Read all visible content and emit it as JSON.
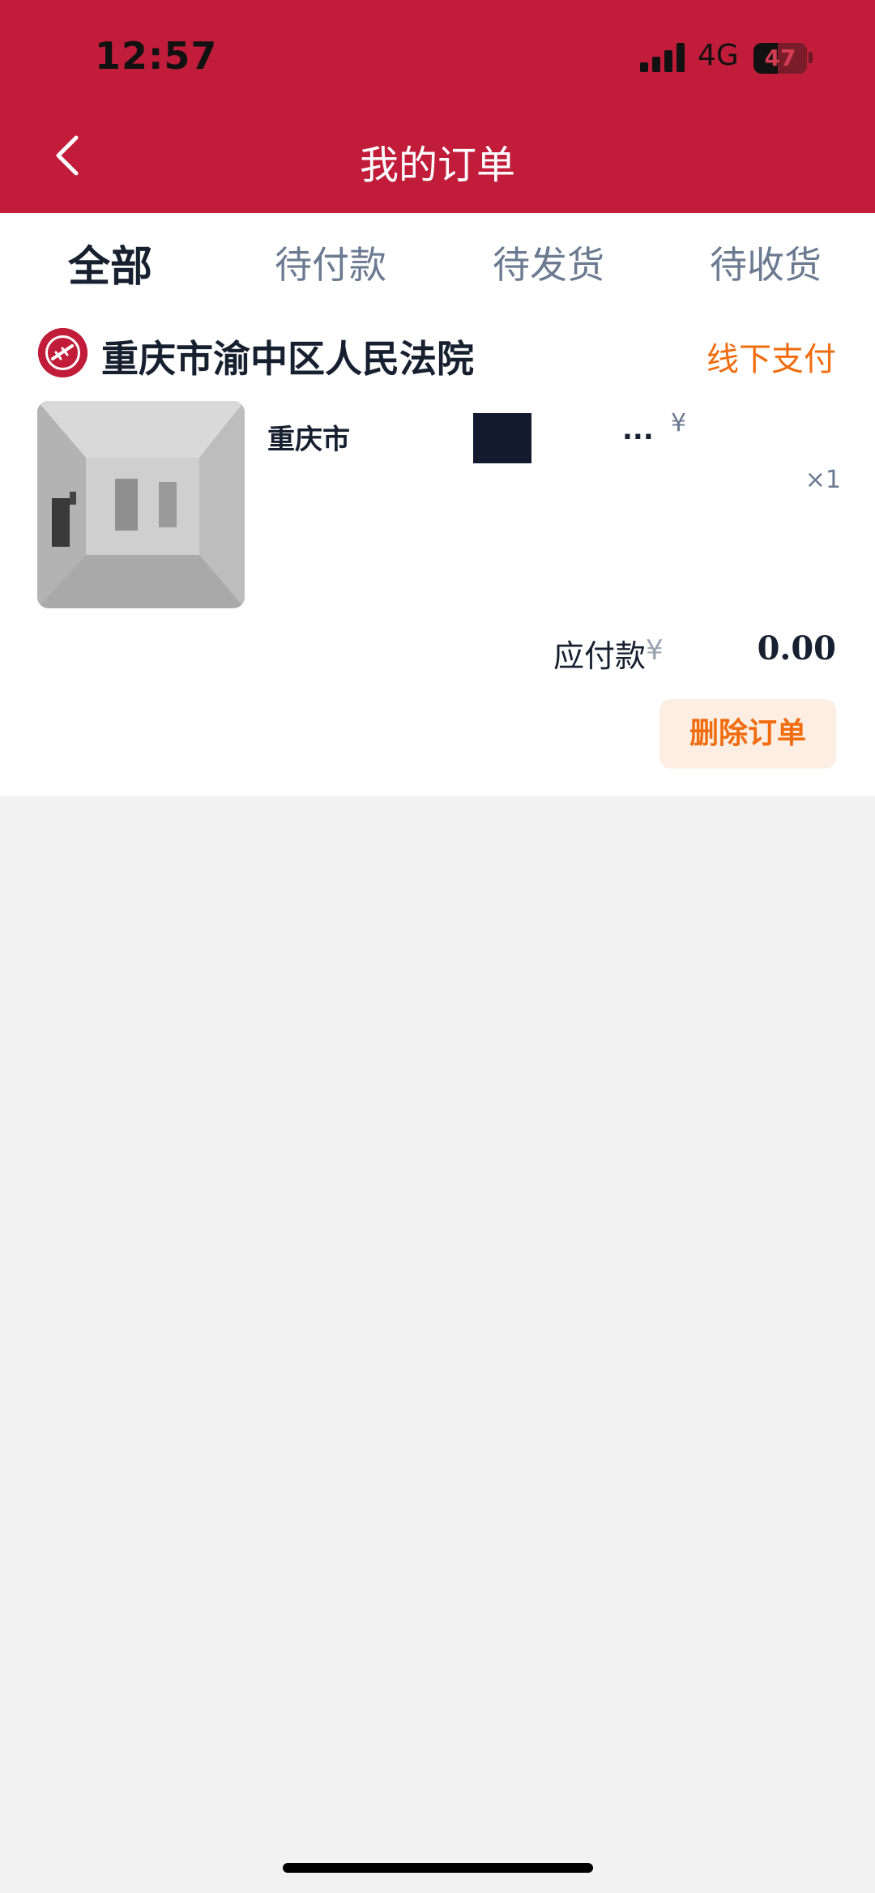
{
  "status_bar": {
    "time": "12:57",
    "network": "4G",
    "battery": "47"
  },
  "nav": {
    "title": "我的订单"
  },
  "tabs": [
    {
      "label": "全部",
      "active": true
    },
    {
      "label": "待付款",
      "active": false
    },
    {
      "label": "待发货",
      "active": false
    },
    {
      "label": "待收货",
      "active": false
    }
  ],
  "order": {
    "shop_name": "重庆市渝中区人民法院",
    "payment_status": "线下支付",
    "item": {
      "title": "重庆市",
      "title_suffix": "...",
      "price_symbol": "¥",
      "quantity": "×1"
    },
    "total": {
      "label": "应付款",
      "currency": "¥",
      "amount": "0.00"
    },
    "delete_label": "删除订单"
  },
  "colors": {
    "brand": "#c11d3a",
    "accent": "#f06c0e",
    "text_primary": "#17202f",
    "text_secondary": "#6b7a90",
    "page_bg": "#f2f2f2"
  }
}
